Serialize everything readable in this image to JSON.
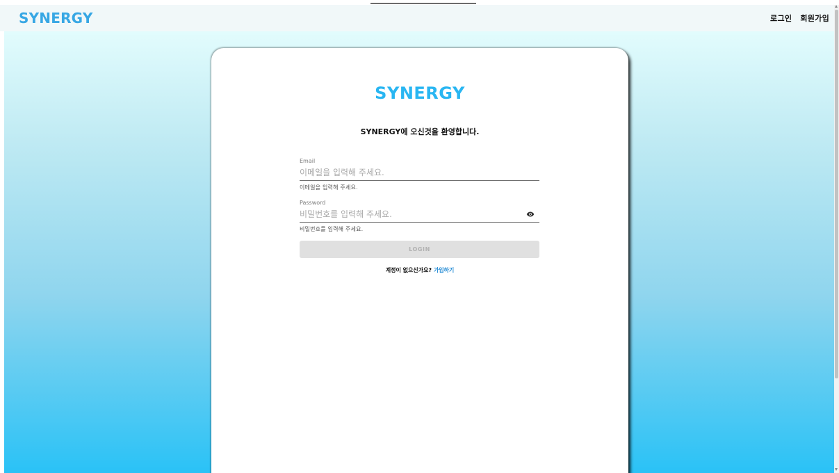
{
  "header": {
    "brand": "SYNERGY",
    "nav": {
      "login": "로그인",
      "signup": "회원가입"
    }
  },
  "card": {
    "logo": "SYNERGY",
    "welcome": "SYNERGY에 오신것을 환영합니다.",
    "email": {
      "label": "Email",
      "placeholder": "이메일을 입력해 주세요.",
      "helper": "이메일을 입력해 주세요.",
      "value": ""
    },
    "password": {
      "label": "Password",
      "placeholder": "비밀번호를 입력해 주세요.",
      "helper": "비밀번호를 입력해 주세요.",
      "value": "",
      "toggle_icon": "eye-icon"
    },
    "login_button": "LOGIN",
    "login_button_disabled": true,
    "signup_prompt": "계정이 없으신가요?",
    "signup_link": "가입하기"
  },
  "colors": {
    "brand": "#37a7e4",
    "card_logo": "#29b6f2",
    "link": "#2b8fd6",
    "gradient_top": "#e2fcfd",
    "gradient_bottom": "#2ac2f6",
    "button_disabled_bg": "#e0e0e0",
    "button_disabled_text": "#b1b1b1"
  }
}
